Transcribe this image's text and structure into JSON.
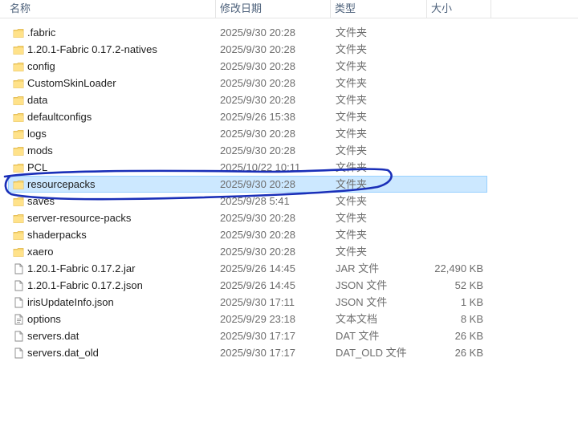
{
  "columns": {
    "name": "名称",
    "date": "修改日期",
    "type": "类型",
    "size": "大小"
  },
  "files": [
    {
      "name": ".fabric",
      "date": "2025/9/30 20:28",
      "type": "文件夹",
      "size": "",
      "icon": "folder-icon"
    },
    {
      "name": "1.20.1-Fabric 0.17.2-natives",
      "date": "2025/9/30 20:28",
      "type": "文件夹",
      "size": "",
      "icon": "folder-icon"
    },
    {
      "name": "config",
      "date": "2025/9/30 20:28",
      "type": "文件夹",
      "size": "",
      "icon": "folder-icon"
    },
    {
      "name": "CustomSkinLoader",
      "date": "2025/9/30 20:28",
      "type": "文件夹",
      "size": "",
      "icon": "folder-icon"
    },
    {
      "name": "data",
      "date": "2025/9/30 20:28",
      "type": "文件夹",
      "size": "",
      "icon": "folder-icon"
    },
    {
      "name": "defaultconfigs",
      "date": "2025/9/26 15:38",
      "type": "文件夹",
      "size": "",
      "icon": "folder-icon"
    },
    {
      "name": "logs",
      "date": "2025/9/30 20:28",
      "type": "文件夹",
      "size": "",
      "icon": "folder-icon"
    },
    {
      "name": "mods",
      "date": "2025/9/30 20:28",
      "type": "文件夹",
      "size": "",
      "icon": "folder-icon"
    },
    {
      "name": "PCL",
      "date": "2025/10/22 10:11",
      "type": "文件夹",
      "size": "",
      "icon": "folder-icon"
    },
    {
      "name": "resourcepacks",
      "date": "2025/9/30 20:28",
      "type": "文件夹",
      "size": "",
      "icon": "folder-icon",
      "selected": true
    },
    {
      "name": "saves",
      "date": "2025/9/28 5:41",
      "type": "文件夹",
      "size": "",
      "icon": "folder-icon"
    },
    {
      "name": "server-resource-packs",
      "date": "2025/9/30 20:28",
      "type": "文件夹",
      "size": "",
      "icon": "folder-icon"
    },
    {
      "name": "shaderpacks",
      "date": "2025/9/30 20:28",
      "type": "文件夹",
      "size": "",
      "icon": "folder-icon"
    },
    {
      "name": "xaero",
      "date": "2025/9/30 20:28",
      "type": "文件夹",
      "size": "",
      "icon": "folder-icon"
    },
    {
      "name": "1.20.1-Fabric 0.17.2.jar",
      "date": "2025/9/26 14:45",
      "type": "JAR 文件",
      "size": "22,490 KB",
      "icon": "file-icon"
    },
    {
      "name": "1.20.1-Fabric 0.17.2.json",
      "date": "2025/9/26 14:45",
      "type": "JSON 文件",
      "size": "52 KB",
      "icon": "file-icon"
    },
    {
      "name": "irisUpdateInfo.json",
      "date": "2025/9/30 17:11",
      "type": "JSON 文件",
      "size": "1 KB",
      "icon": "file-icon"
    },
    {
      "name": "options",
      "date": "2025/9/29 23:18",
      "type": "文本文档",
      "size": "8 KB",
      "icon": "text-document-icon"
    },
    {
      "name": "servers.dat",
      "date": "2025/9/30 17:17",
      "type": "DAT 文件",
      "size": "26 KB",
      "icon": "file-icon"
    },
    {
      "name": "servers.dat_old",
      "date": "2025/9/30 17:17",
      "type": "DAT_OLD 文件",
      "size": "26 KB",
      "icon": "file-icon"
    }
  ],
  "colors": {
    "selection_bg": "#cce8ff",
    "selection_border": "#99d1ff",
    "folder_yellow": "#f8d775",
    "annotation_ink": "#1a2fb8",
    "header_text": "#4c607a"
  }
}
